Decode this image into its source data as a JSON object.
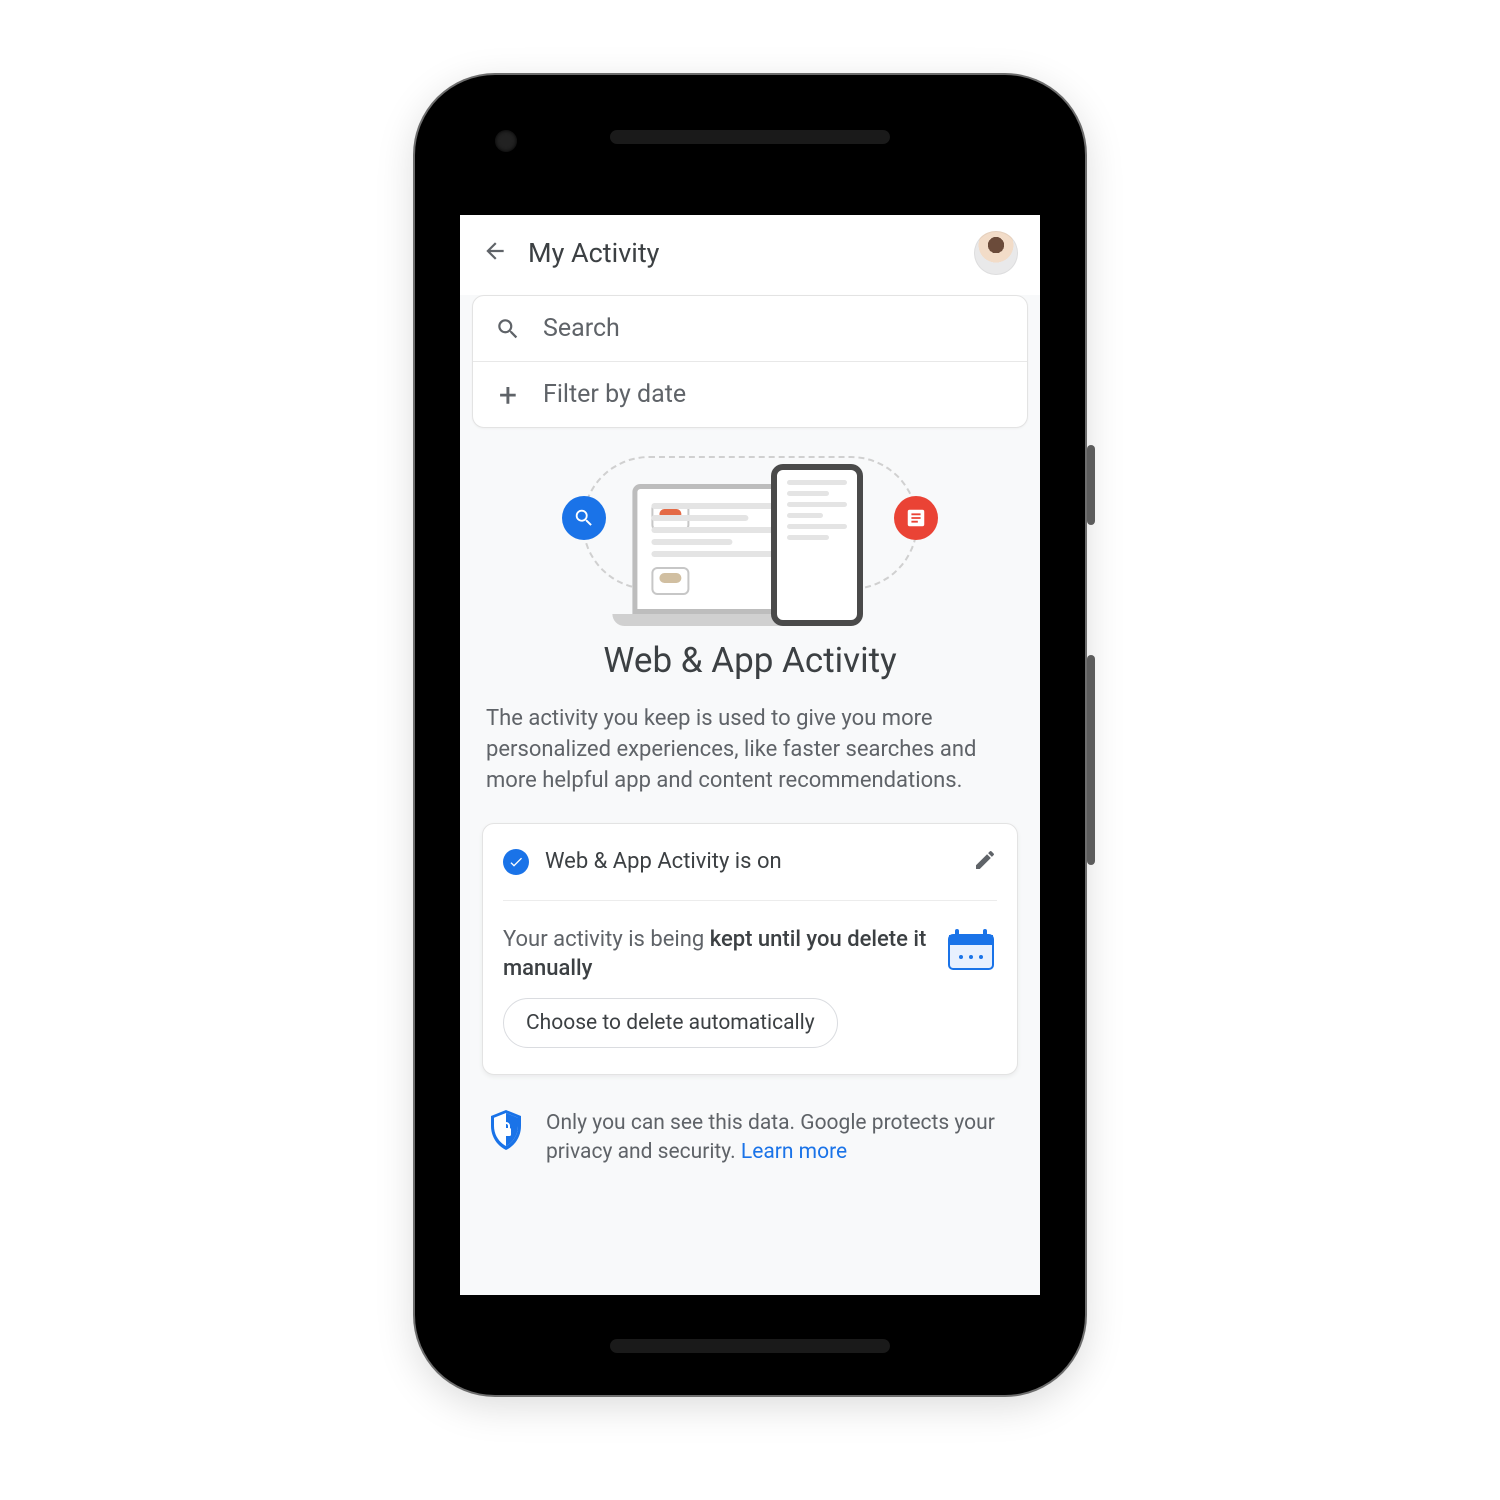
{
  "appbar": {
    "title": "My Activity"
  },
  "search": {
    "placeholder": "Search",
    "filter_label": "Filter by date"
  },
  "hero": {
    "title": "Web & App Activity",
    "description": "The activity you keep is used to give you more personalized experiences, like faster searches and more helpful app and content recommendations."
  },
  "status": {
    "on_label": "Web & App Activity is on",
    "keep_prefix": "Your activity is being ",
    "keep_bold": "kept until you delete it manually",
    "auto_delete_btn": "Choose to delete automatically"
  },
  "privacy": {
    "text": "Only you can see this data. Google protects your privacy and security. ",
    "learn_more": "Learn more"
  },
  "icons": {
    "back": "arrow_back",
    "search": "search",
    "plus": "add",
    "edit": "edit",
    "check": "check",
    "shield": "shield-lock",
    "calendar": "calendar",
    "magnify_badge": "search",
    "doc_badge": "article"
  },
  "colors": {
    "blue": "#1a73e8",
    "red": "#ea4335",
    "grey_text": "#5f6368",
    "surface": "#ffffff",
    "bg": "#f8f9fa"
  }
}
